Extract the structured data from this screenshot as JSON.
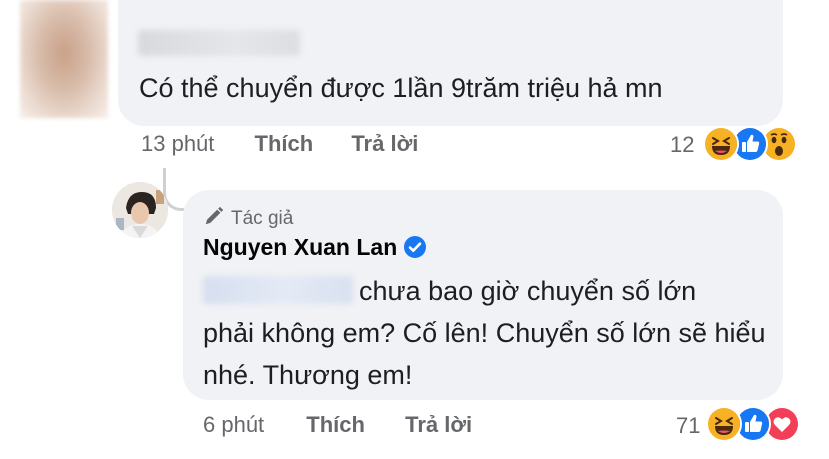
{
  "comment": {
    "text": "Có thể chuyển được 1lần 9trăm triệu hả mn",
    "time": "13 phút",
    "like_label": "Thích",
    "reply_label": "Trả lời",
    "reaction_count": "12",
    "reactions": [
      "haha-icon",
      "like-icon",
      "wow-icon"
    ]
  },
  "reply": {
    "badge": "Tác giả",
    "author": "Nguyen Xuan Lan",
    "verified": true,
    "text_line1": "chưa bao giờ chuyển số lớn",
    "text_rest": "phải không em? Cố lên! Chuyển số lớn sẽ hiểu nhé. Thương em!",
    "time": "6 phút",
    "like_label": "Thích",
    "reply_label": "Trả lời",
    "reaction_count": "71",
    "reactions": [
      "haha-icon",
      "like-icon",
      "love-icon"
    ]
  },
  "colors": {
    "bubble": "#f0f2f5",
    "meta_text": "#65676b",
    "like_blue": "#1877f2",
    "love_red": "#f33e58",
    "emoji_yellow": "#f7b125"
  }
}
